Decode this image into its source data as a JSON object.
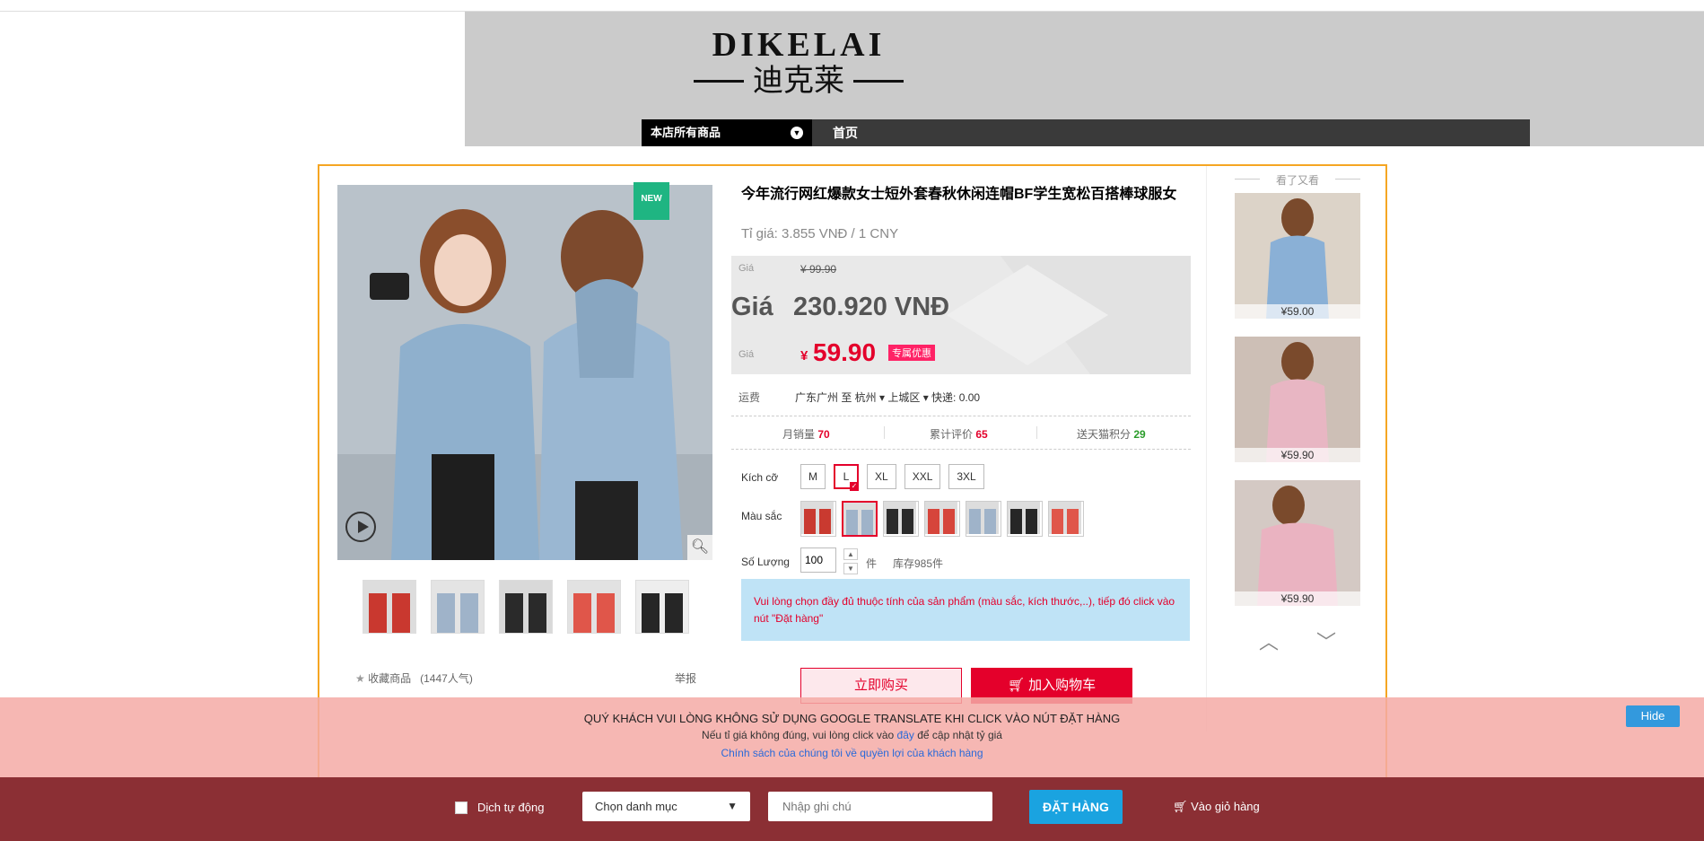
{
  "header": {
    "logo_en": "DIKELAI",
    "logo_cn": "迪克莱",
    "nav_all": "本店所有商品",
    "nav_home": "首页"
  },
  "product": {
    "badge": "NEW",
    "title": "今年流行网红爆款女士短外套春秋休闲连帽BF学生宽松百搭棒球服女",
    "exchange_rate": "Tỉ giá: 3.855 VNĐ / 1 CNY",
    "orig_label": "Giá",
    "orig_price": "¥ 99.90",
    "vnd_label": "Giá",
    "vnd_price": "230.920 VNĐ",
    "price_label": "Giá",
    "price_currency": "¥",
    "price": "59.90",
    "promo": "专属优惠",
    "ship_label": "运费",
    "ship_value": "广东广州 至 杭州 ▾ 上城区 ▾ 快递: 0.00",
    "stats": {
      "monthly_label": "月销量",
      "monthly": "70",
      "reviews_label": "累计评价",
      "reviews": "65",
      "points_label": "送天猫积分",
      "points": "29"
    },
    "size_label": "Kích cỡ",
    "sizes": [
      "M",
      "L",
      "XL",
      "XXL",
      "3XL"
    ],
    "selected_size": "L",
    "color_label": "Màu sắc",
    "colors": [
      "#c93a30",
      "#9fb3c9",
      "#2a2a2a",
      "#d6453b",
      "#9fb3c9",
      "#262626",
      "#e0564a"
    ],
    "qty_label": "Số Lượng",
    "qty": "100",
    "qty_unit": "件",
    "stock": "库存985件",
    "notice": "Vui lòng chọn đầy đủ thuộc tính của sản phẩm (màu sắc, kích thước,..), tiếp đó click vào nút \"Đặt hàng\"",
    "buy_now": "立即购买",
    "add_cart": "加入购物车",
    "favorite": "收藏商品",
    "popularity": "(1447人气)",
    "report": "举报"
  },
  "recommend": {
    "title": "看了又看",
    "items": [
      {
        "price": "¥59.00",
        "color": "#8ab0d6"
      },
      {
        "price": "¥59.90",
        "color": "#e8b6c3"
      },
      {
        "price": "¥59.90",
        "color": "#eab3c1"
      }
    ]
  },
  "overlay": {
    "line1": "QUÝ KHÁCH VUI LÒNG KHÔNG SỬ DỤNG GOOGLE TRANSLATE KHI CLICK VÀO NÚT ĐẶT HÀNG",
    "line2_pre": "Nếu tỉ giá không đúng, vui lòng click vào",
    "line2_link": "đây",
    "line2_post": "để cập nhật tỷ giá",
    "line3": "Chính sách của chúng tôi về quyền lợi của khách hàng",
    "hide": "Hide"
  },
  "bottombar": {
    "auto_translate": "Dịch tự động",
    "category_placeholder": "Chọn danh mục",
    "note_placeholder": "Nhập ghi chú",
    "order": "ĐẶT HÀNG",
    "cart": "Vào giỏ hàng"
  }
}
